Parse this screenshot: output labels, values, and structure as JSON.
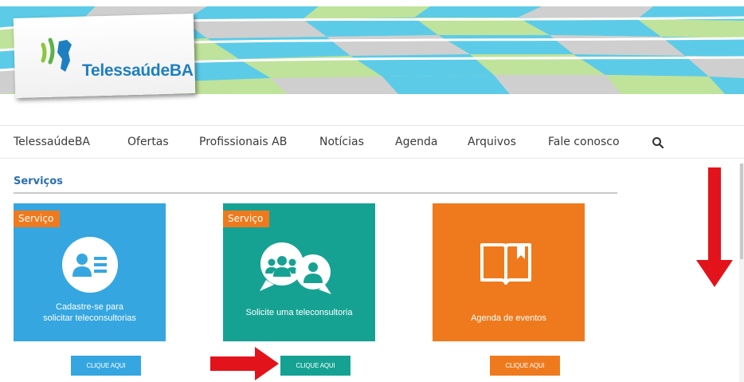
{
  "brand": {
    "name": "TelessaúdeBA",
    "color": "#1e7fc0"
  },
  "nav": {
    "items": [
      "TelessaúdeBA",
      "Ofertas",
      "Profissionais AB",
      "Notícias",
      "Agenda",
      "Arquivos",
      "Fale conosco"
    ],
    "search_icon": "search-icon"
  },
  "section": {
    "title": "Serviços"
  },
  "cards": [
    {
      "tag": "Serviço",
      "caption_line1": "Cadastre-se para",
      "caption_line2": "solicitar teleconsultorias",
      "icon": "user-card-icon",
      "color": "#35a6e0",
      "button": "CLIQUE AQUI"
    },
    {
      "tag": "Serviço",
      "caption_line1": "Solicite uma teleconsultoria",
      "caption_line2": "",
      "icon": "group-chat-icon",
      "color": "#16a293",
      "button": "CLIQUE AQUI"
    },
    {
      "tag": "",
      "caption_line1": "Agenda de eventos",
      "caption_line2": "",
      "icon": "open-book-icon",
      "color": "#ef7a1d",
      "button": "CLIQUE AQUI"
    }
  ],
  "annotations": {
    "arrow_color": "#e3131b"
  }
}
